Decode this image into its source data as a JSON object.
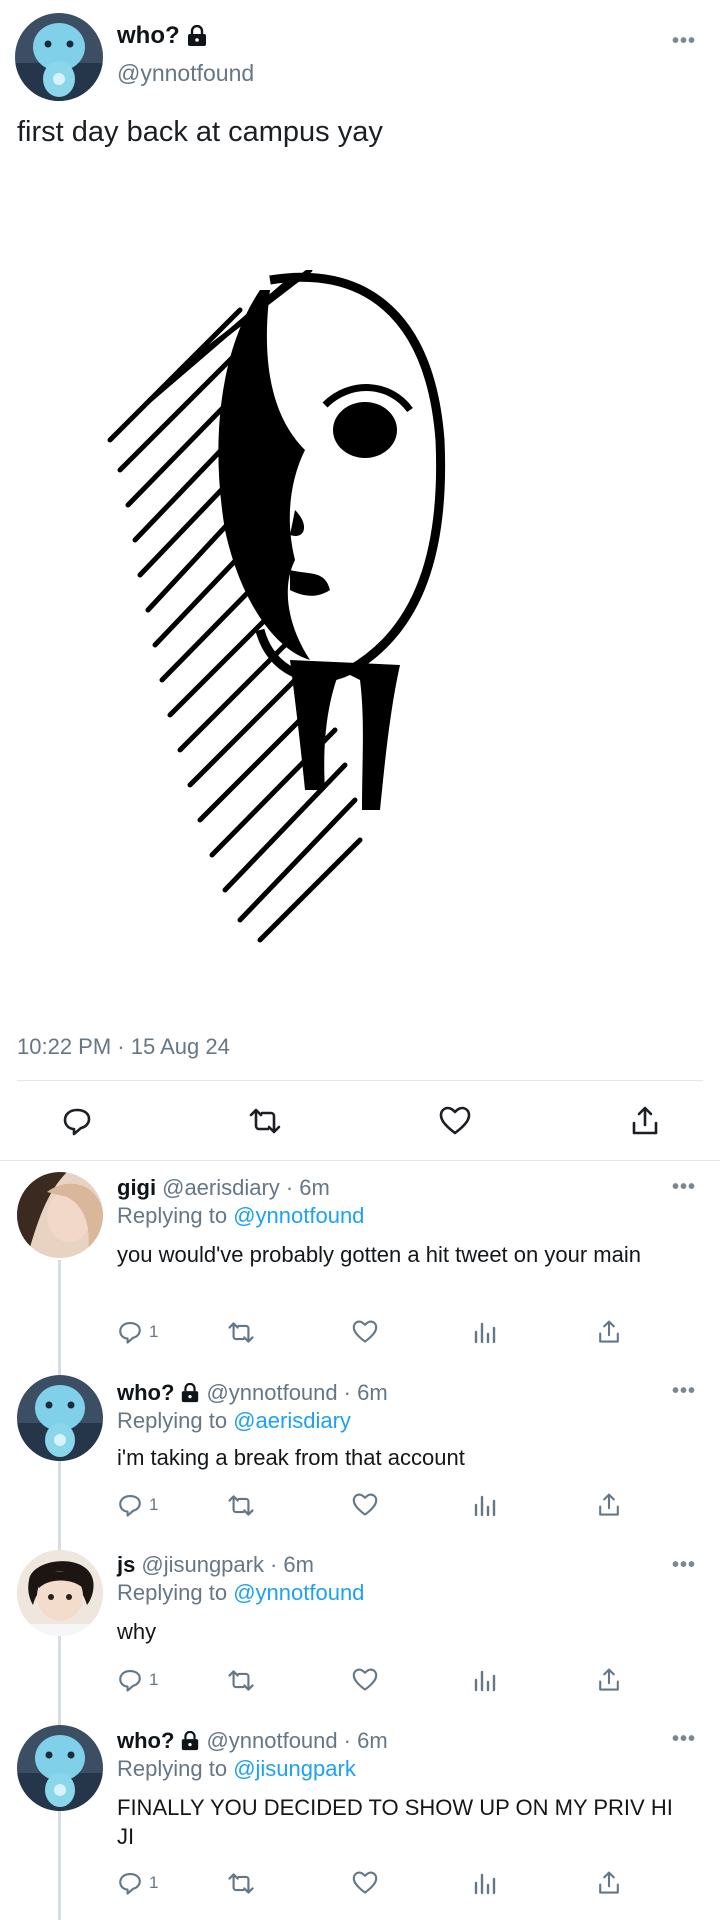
{
  "main_tweet": {
    "name": "who?",
    "handle": "@ynnotfound",
    "text": "first day back at campus yay",
    "timestamp": "10:22 PM · 15 Aug 24",
    "more_label": "•••",
    "image_icon": "sketch-face-drawing",
    "actions": [
      "reply-icon",
      "retweet-icon",
      "like-icon",
      "share-icon"
    ]
  },
  "replies": [
    {
      "name": "gigi",
      "handle": "@aerisdiary",
      "time": "· 6m",
      "replying_prefix": "Replying to",
      "replying_to": "@ynnotfound",
      "text": "you would've probably gotten a hit tweet on your main",
      "reply_count": "1",
      "avatar": "photo-avatar"
    },
    {
      "name": "who?",
      "handle": "@ynnotfound",
      "time": "· 6m",
      "replying_prefix": "Replying to",
      "replying_to": "@aerisdiary",
      "text": "i'm taking a break from that account",
      "reply_count": "1",
      "avatar": "blue-figure-avatar"
    },
    {
      "name": "js",
      "handle": "@jisungpark",
      "time": "· 6m",
      "replying_prefix": "Replying to",
      "replying_to": "@ynnotfound",
      "text": "why",
      "reply_count": "1",
      "avatar": "photo-avatar"
    },
    {
      "name": "who?",
      "handle": "@ynnotfound",
      "time": "· 6m",
      "replying_prefix": "Replying to",
      "replying_to": "@jisungpark",
      "text": "FINALLY YOU DECIDED TO SHOW UP ON MY PRIV HI JI",
      "reply_count": "1",
      "avatar": "blue-figure-avatar"
    }
  ],
  "colors": {
    "link": "#1da1f2",
    "muted": "#657786",
    "divider": "#e1e8ed"
  }
}
